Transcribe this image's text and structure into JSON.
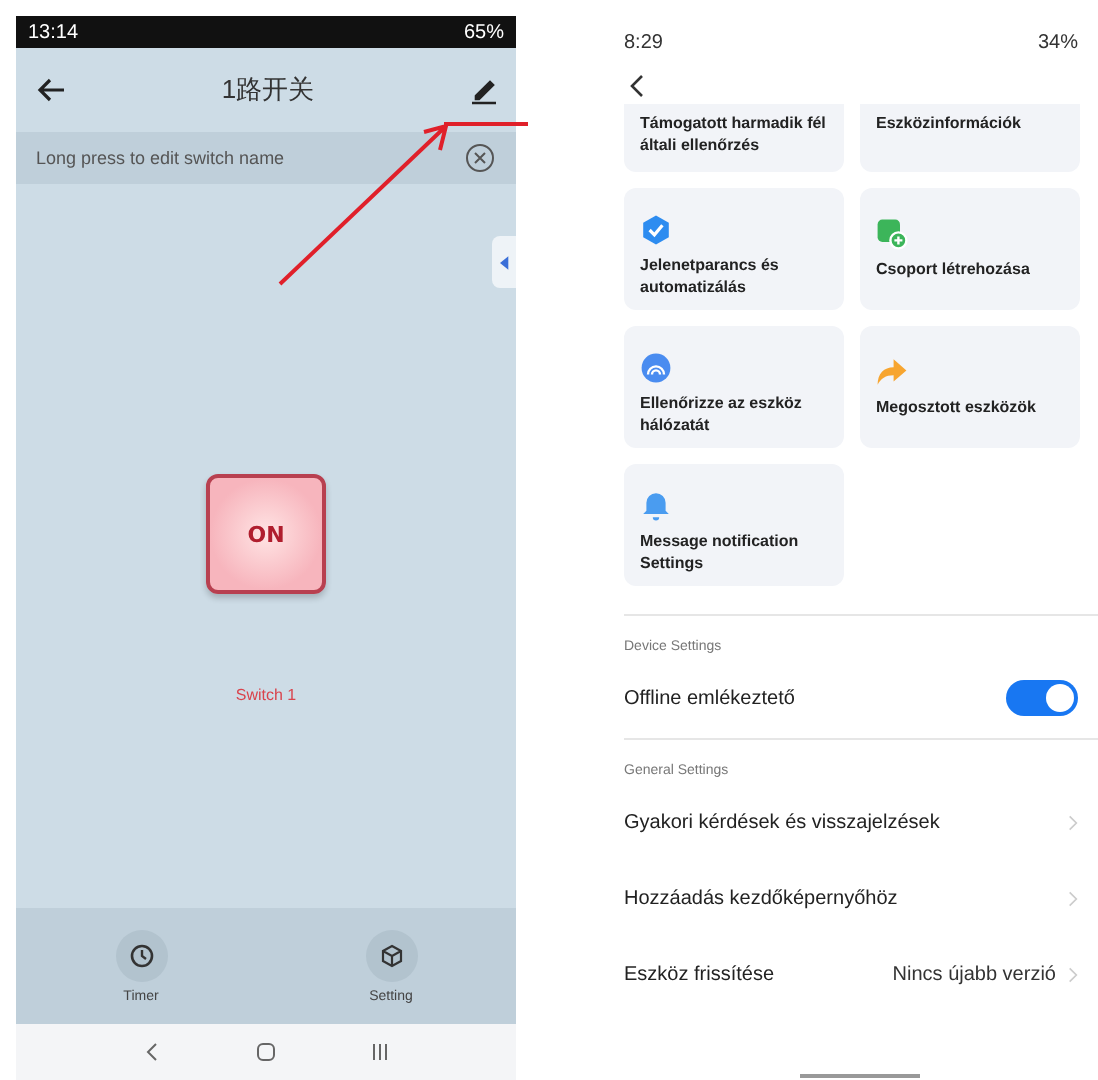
{
  "left_phone": {
    "status_bar": {
      "time": "13:14",
      "battery": "65%"
    },
    "header": {
      "title": "1路开关"
    },
    "hint_bar": {
      "text": "Long press to edit switch name"
    },
    "switch": {
      "label": "ON",
      "on": true,
      "name": "Switch 1"
    },
    "bottom_bar": [
      {
        "kind": "timer",
        "label": "Timer"
      },
      {
        "kind": "setting",
        "label": "Setting"
      }
    ]
  },
  "right_phone": {
    "status_bar": {
      "time": "8:29",
      "battery": "34%"
    },
    "cards": [
      {
        "kind": "none",
        "title": "Támogatott harmadik fél általi ellenőrzés"
      },
      {
        "kind": "info",
        "title": "Eszközinformációk"
      },
      {
        "kind": "scene",
        "title": "Jelenetparancs és automatizálás"
      },
      {
        "kind": "group",
        "title": "Csoport létrehozása"
      },
      {
        "kind": "network",
        "title": "Ellenőrizze az eszköz hálózatát"
      },
      {
        "kind": "share",
        "title": "Megosztott eszközök"
      },
      {
        "kind": "bell",
        "title": "Message notification Settings"
      }
    ],
    "device_settings": {
      "heading": "Device Settings",
      "rows": [
        {
          "label": "Offline emlékeztető",
          "on": true
        }
      ]
    },
    "general_settings": {
      "heading": "General Settings",
      "rows": [
        {
          "label": "Gyakori kérdések és visszajelzések"
        },
        {
          "label": "Hozzáadás kezdőképernyőhöz"
        },
        {
          "label": "Eszköz frissítése",
          "value": "Nincs újabb verzió"
        }
      ]
    }
  }
}
